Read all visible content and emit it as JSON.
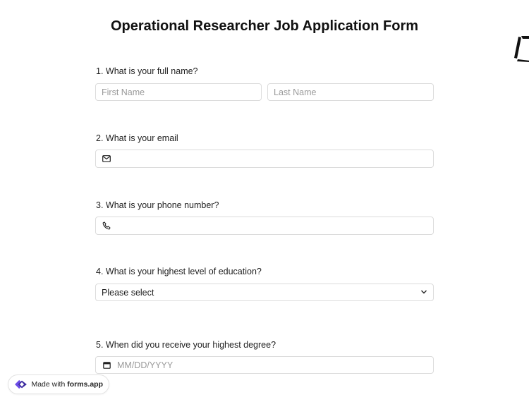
{
  "form": {
    "title": "Operational Researcher Job Application Form",
    "questions": [
      {
        "label": "1.  What is your full name?",
        "first_name_placeholder": "First Name",
        "last_name_placeholder": "Last Name"
      },
      {
        "label": "2. What is your email",
        "icon": "envelope-icon"
      },
      {
        "label": "3. What is your phone number?",
        "icon": "phone-icon"
      },
      {
        "label": "4. What is your highest level of education?",
        "select_value": "Please select"
      },
      {
        "label": "5. When did you receive your highest degree?",
        "date_placeholder": "MM/DD/YYYY",
        "icon": "calendar-icon"
      }
    ]
  },
  "badge": {
    "prefix": "Made with ",
    "brand": "forms.app"
  },
  "colors": {
    "border": "#dcdcdc",
    "placeholder": "#9a9a9a",
    "logo": "#6c4de6"
  }
}
